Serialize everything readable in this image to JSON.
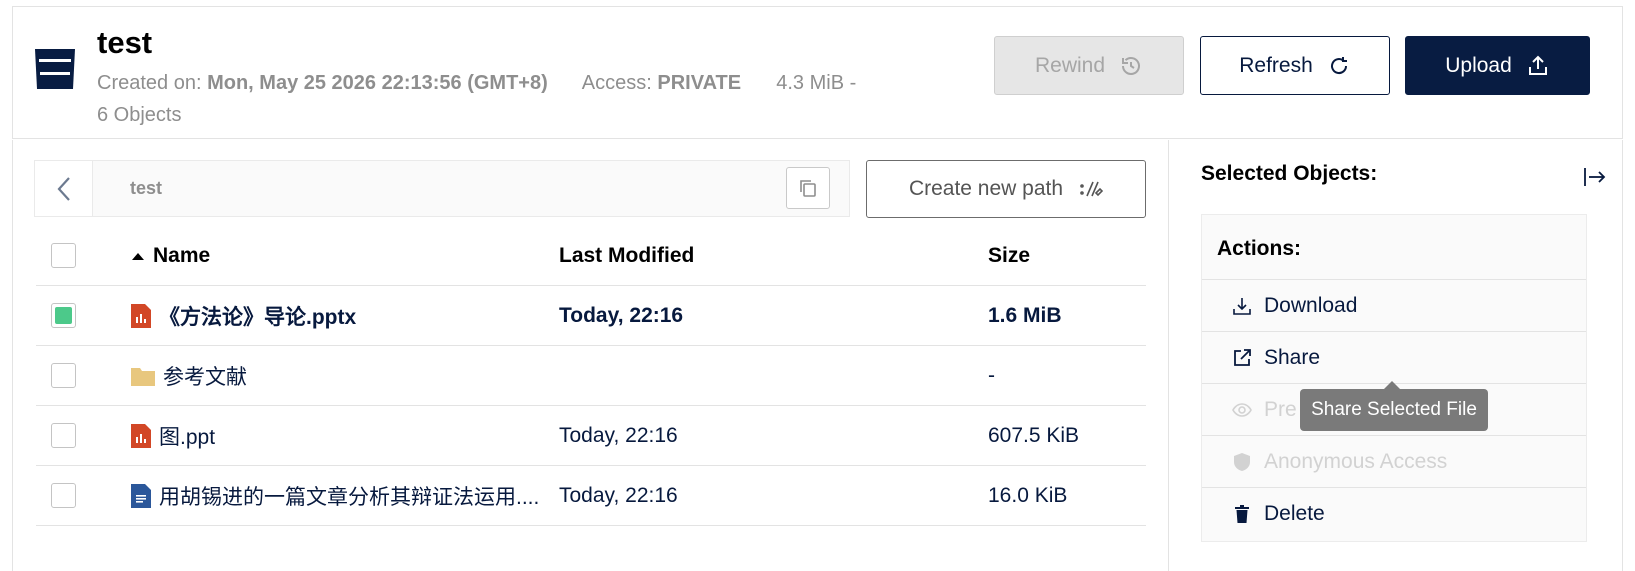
{
  "bucket": {
    "title": "test",
    "created_label": "Created on:",
    "created_value": "Mon, May 25 2026 22:13:56 (GMT+8)",
    "access_label": "Access:",
    "access_value": "PRIVATE",
    "size_summary": "4.3 MiB -",
    "objects_summary": "6 Objects"
  },
  "toolbar": {
    "rewind_label": "Rewind",
    "refresh_label": "Refresh",
    "upload_label": "Upload"
  },
  "browser": {
    "breadcrumb": "test",
    "create_path_label": "Create new path"
  },
  "table": {
    "columns": {
      "name": "Name",
      "last_modified": "Last Modified",
      "size": "Size"
    },
    "rows": [
      {
        "icon": "pptx-file-icon",
        "name": "《方法论》导论.pptx",
        "modified": "Today, 22:16",
        "size": "1.6 MiB",
        "selected": true
      },
      {
        "icon": "folder-icon",
        "name": "参考文献",
        "modified": "",
        "size": "-",
        "selected": false
      },
      {
        "icon": "ppt-file-icon",
        "name": "图.ppt",
        "modified": "Today, 22:16",
        "size": "607.5 KiB",
        "selected": false
      },
      {
        "icon": "doc-file-icon",
        "name": "用胡锡进的一篇文章分析其辩证法运用....",
        "modified": "Today, 22:16",
        "size": "16.0 KiB",
        "selected": false
      }
    ]
  },
  "panel": {
    "title": "Selected Objects:",
    "actions_title": "Actions:",
    "actions": {
      "download": "Download",
      "share": "Share",
      "preview": "Pre",
      "anonymous": "Anonymous Access",
      "delete": "Delete"
    },
    "tooltip": "Share Selected File"
  },
  "colors": {
    "brand": "#081c42",
    "checkbox_checked": "#4cc98a",
    "ppt_icon": "#d24726",
    "doc_icon": "#2b579a",
    "folder_icon": "#e8c77e"
  }
}
